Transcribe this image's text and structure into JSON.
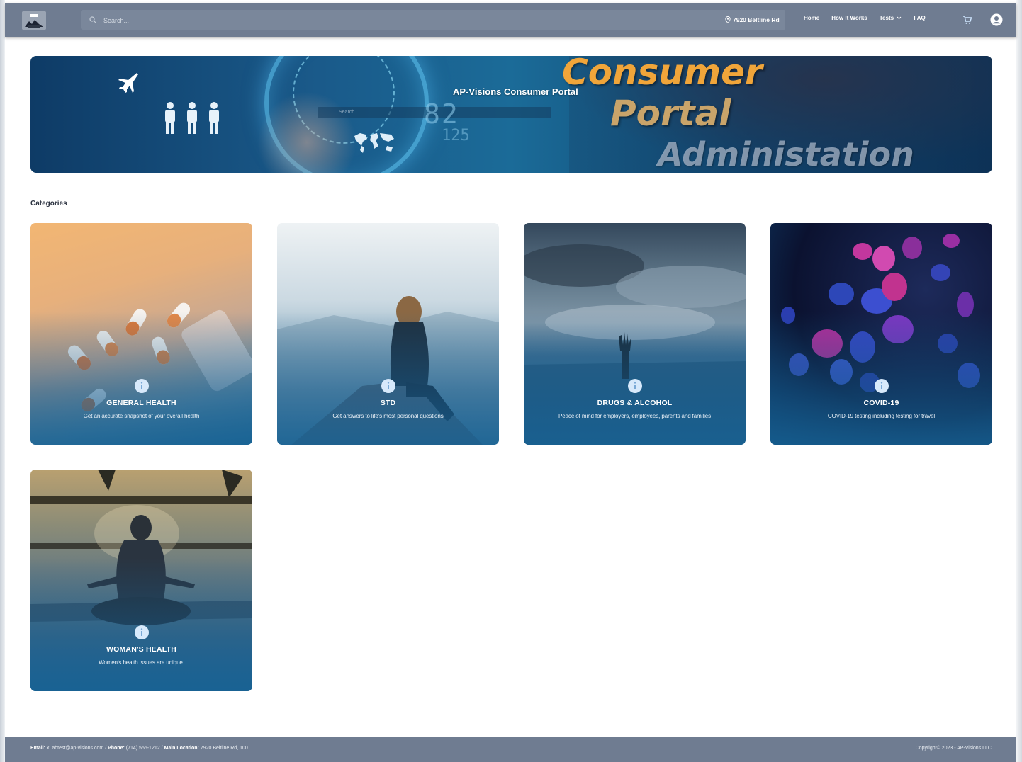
{
  "navbar": {
    "search_placeholder": "Search...",
    "location": "7920 Beltline Rd",
    "links": {
      "home": "Home",
      "how_it_works": "How It Works",
      "tests": "Tests",
      "faq": "FAQ"
    }
  },
  "hero": {
    "title": "AP-Visions Consumer Portal",
    "line1": "Consumer",
    "line2": "Portal",
    "line3": "Administation",
    "mini_search_placeholder": "Search...",
    "digits_large": "82",
    "digits_small": "125"
  },
  "categories": {
    "heading": "Categories",
    "items": [
      {
        "title": "GENERAL HEALTH",
        "description": "Get an accurate snapshot of your overall health"
      },
      {
        "title": "STD",
        "description": "Get answers to life's most personal questions"
      },
      {
        "title": "DRUGS & ALCOHOL",
        "description": "Peace of mind for employers, employees, parents and families"
      },
      {
        "title": "COVID-19",
        "description": "COVID-19 testing including testing for travel"
      },
      {
        "title": "WOMAN'S HEALTH",
        "description": "Women's health issues are unique."
      }
    ]
  },
  "footer": {
    "email_label": "Email:",
    "email": "xLabtest@ap-visions.com",
    "phone_label": "Phone:",
    "phone": "(714) 555-1212",
    "location_label": "Main Location:",
    "location": "7920 Beltline Rd, 100",
    "copyright": "Copyright© 2023 - AP-Visions LLC"
  },
  "colors": {
    "navbar": "#6f7c91",
    "accent_orange": "#f0a53a",
    "card_overlay": "#1a6096"
  },
  "icons": [
    "logo-icon",
    "search-icon",
    "location-pin-icon",
    "chevron-down-icon",
    "cart-icon",
    "account-icon",
    "info-icon"
  ]
}
